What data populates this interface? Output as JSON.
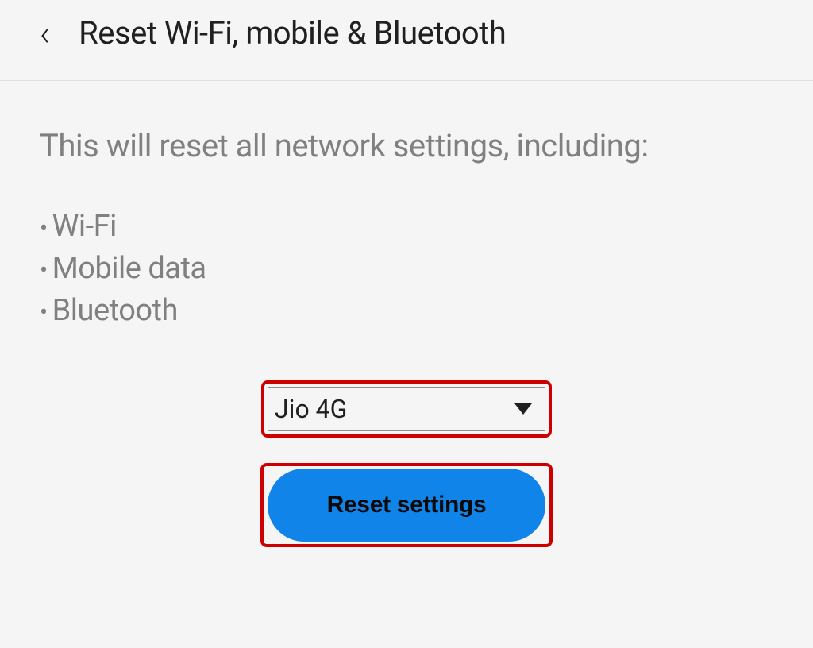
{
  "header": {
    "title": "Reset Wi-Fi, mobile & Bluetooth"
  },
  "content": {
    "description": "This will reset all network settings, including:",
    "bullets": [
      "Wi-Fi",
      "Mobile data",
      "Bluetooth"
    ],
    "dropdown": {
      "selected": "Jio 4G"
    },
    "button": {
      "label": "Reset settings"
    }
  }
}
